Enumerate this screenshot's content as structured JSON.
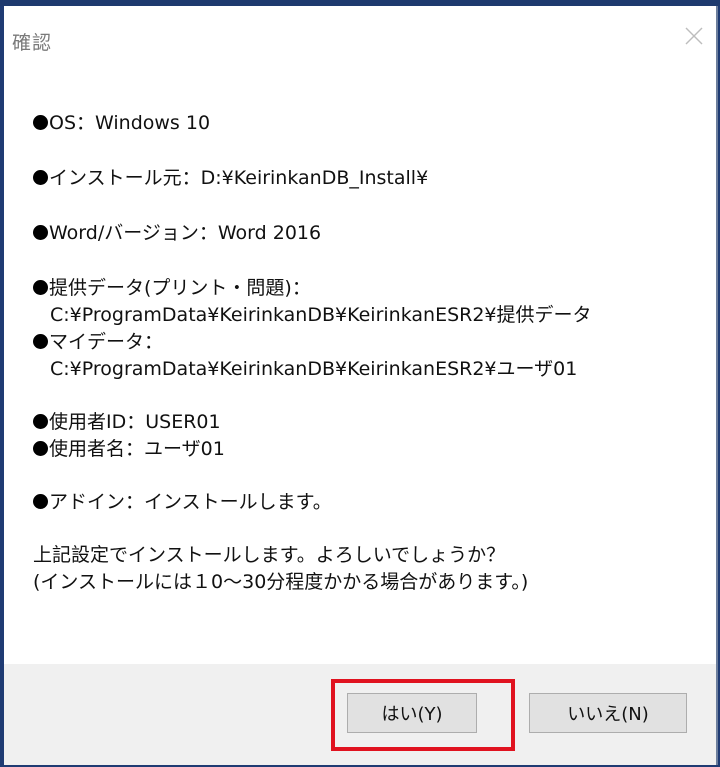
{
  "window": {
    "title": "確認",
    "close_icon": "close-icon"
  },
  "message": {
    "os_line": "OS：Windows 10",
    "install_source_line": "インストール元：D:¥KeirinkanDB_Install¥",
    "word_version_line": "Word/バージョン：Word 2016",
    "provided_data_label": "提供データ(プリント・問題)：",
    "provided_data_path": "C:¥ProgramData¥KeirinkanDB¥KeirinkanESR2¥提供データ",
    "my_data_label": "マイデータ：",
    "my_data_path": "C:¥ProgramData¥KeirinkanDB¥KeirinkanESR2¥ユーザ01",
    "user_id_line": "使用者ID：USER01",
    "user_name_line": "使用者名：ユーザ01",
    "addin_line": "アドイン：インストールします。",
    "confirm_question": "上記設定でインストールします。よろしいでしょうか？",
    "confirm_note": "(インストールには１0～30分程度かかる場合があります。)"
  },
  "buttons": {
    "yes_label": "はい(Y)",
    "no_label": "いいえ(N)"
  },
  "colors": {
    "highlight_border": "#e0121f",
    "footer_background": "#f0f0f0",
    "button_background": "#e1e1e1"
  }
}
